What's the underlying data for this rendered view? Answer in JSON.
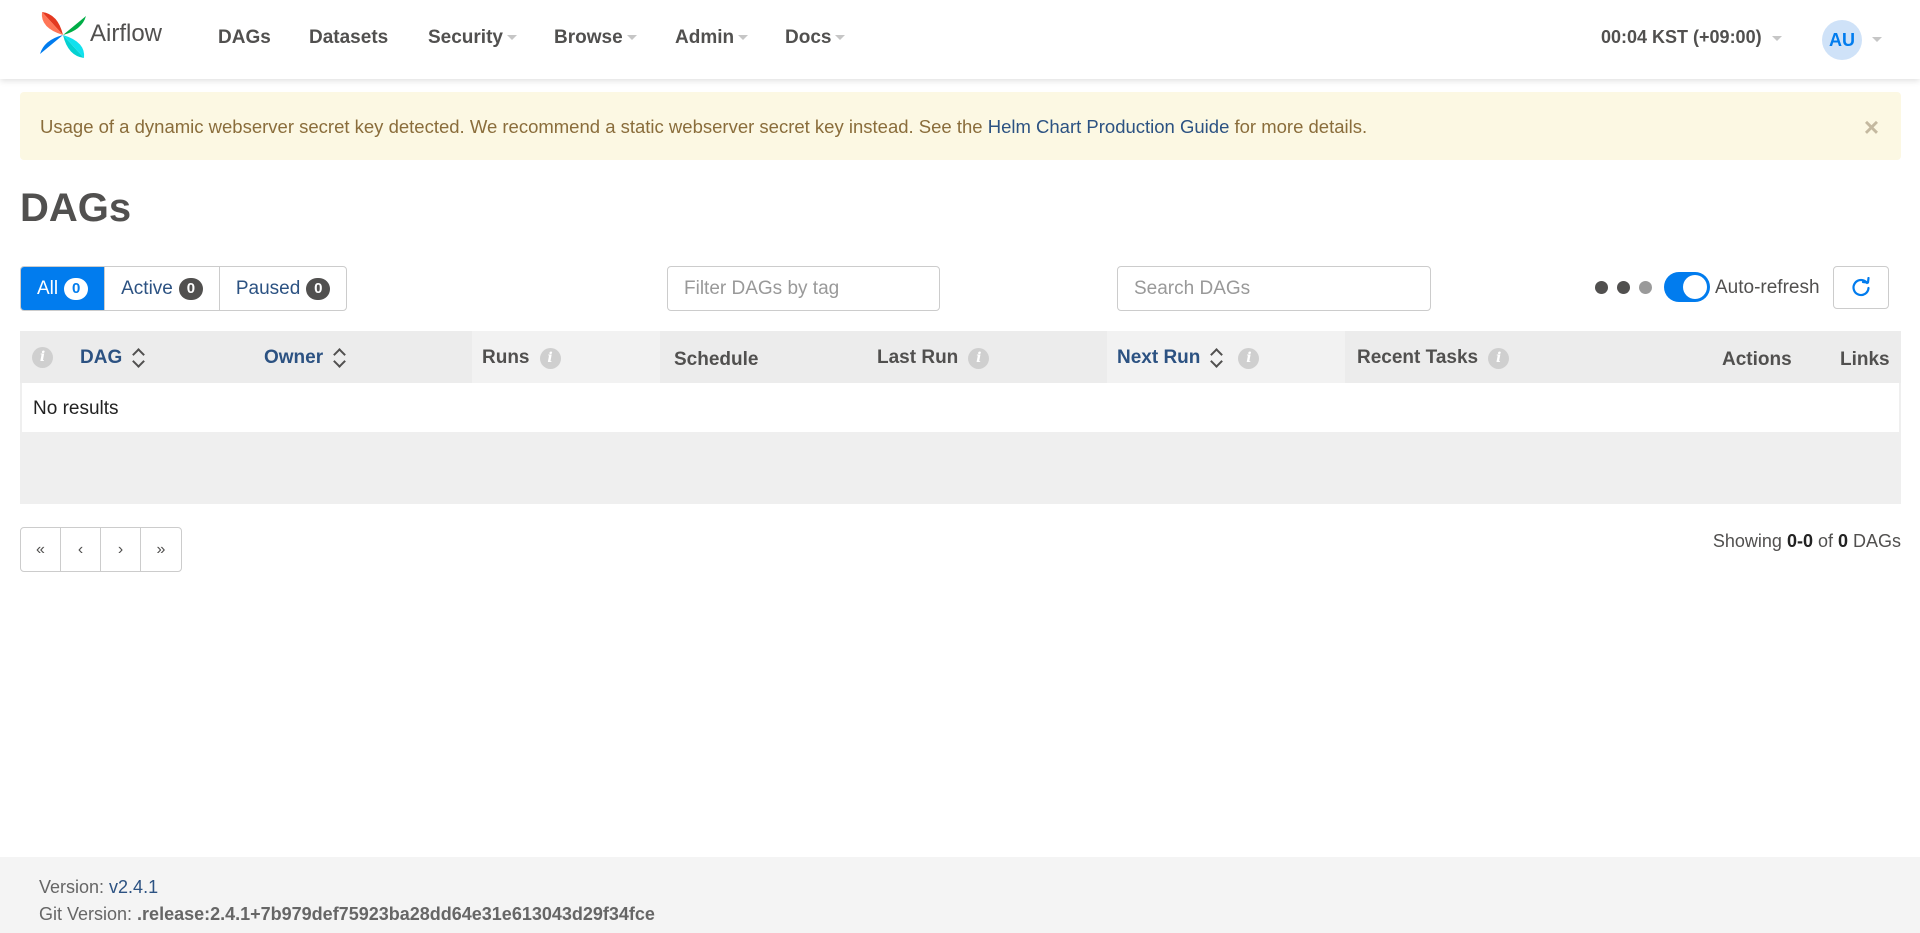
{
  "nav": {
    "brand": "Airflow",
    "items": [
      "DAGs",
      "Datasets",
      "Security",
      "Browse",
      "Admin",
      "Docs"
    ],
    "clock": "00:04 KST (+09:00)",
    "avatar": "AU"
  },
  "alert": {
    "text_before": "Usage of a dynamic webserver secret key detected. We recommend a static webserver secret key instead. See the ",
    "link": "Helm Chart Production Guide",
    "text_after": " for more details.",
    "close": "×"
  },
  "page": {
    "title": "DAGs"
  },
  "status_filter": {
    "all": {
      "label": "All",
      "count": "0"
    },
    "active": {
      "label": "Active",
      "count": "0"
    },
    "paused": {
      "label": "Paused",
      "count": "0"
    }
  },
  "filters": {
    "tag_placeholder": "Filter DAGs by tag",
    "search_placeholder": "Search DAGs"
  },
  "auto_refresh": {
    "label": "Auto-refresh",
    "enabled": true
  },
  "table": {
    "columns": {
      "dag": "DAG",
      "owner": "Owner",
      "runs": "Runs",
      "schedule": "Schedule",
      "last_run": "Last Run",
      "next_run": "Next Run",
      "recent_tasks": "Recent Tasks",
      "actions": "Actions",
      "links": "Links"
    },
    "empty": "No results"
  },
  "pagination": {
    "buttons": [
      "«",
      "‹",
      "›",
      "»"
    ],
    "showing_prefix": "Showing ",
    "showing_range": "0-0",
    "showing_of": " of ",
    "showing_total": "0",
    "showing_suffix": " DAGs"
  },
  "footer": {
    "version_label": "Version: ",
    "version": "v2.4.1",
    "git_label": "Git Version: ",
    "git_version": ".release:2.4.1+7b979def75923ba28dd64e31e613043d29f34fce"
  },
  "colors": {
    "accent": "#017cee",
    "link": "#2c5282",
    "alert_bg": "#fcf8e3",
    "alert_text": "#8a6d3b"
  },
  "icons": [
    "pinwheel-logo-icon",
    "caret-down-icon",
    "close-icon",
    "info-icon",
    "sort-icon",
    "refresh-icon"
  ]
}
